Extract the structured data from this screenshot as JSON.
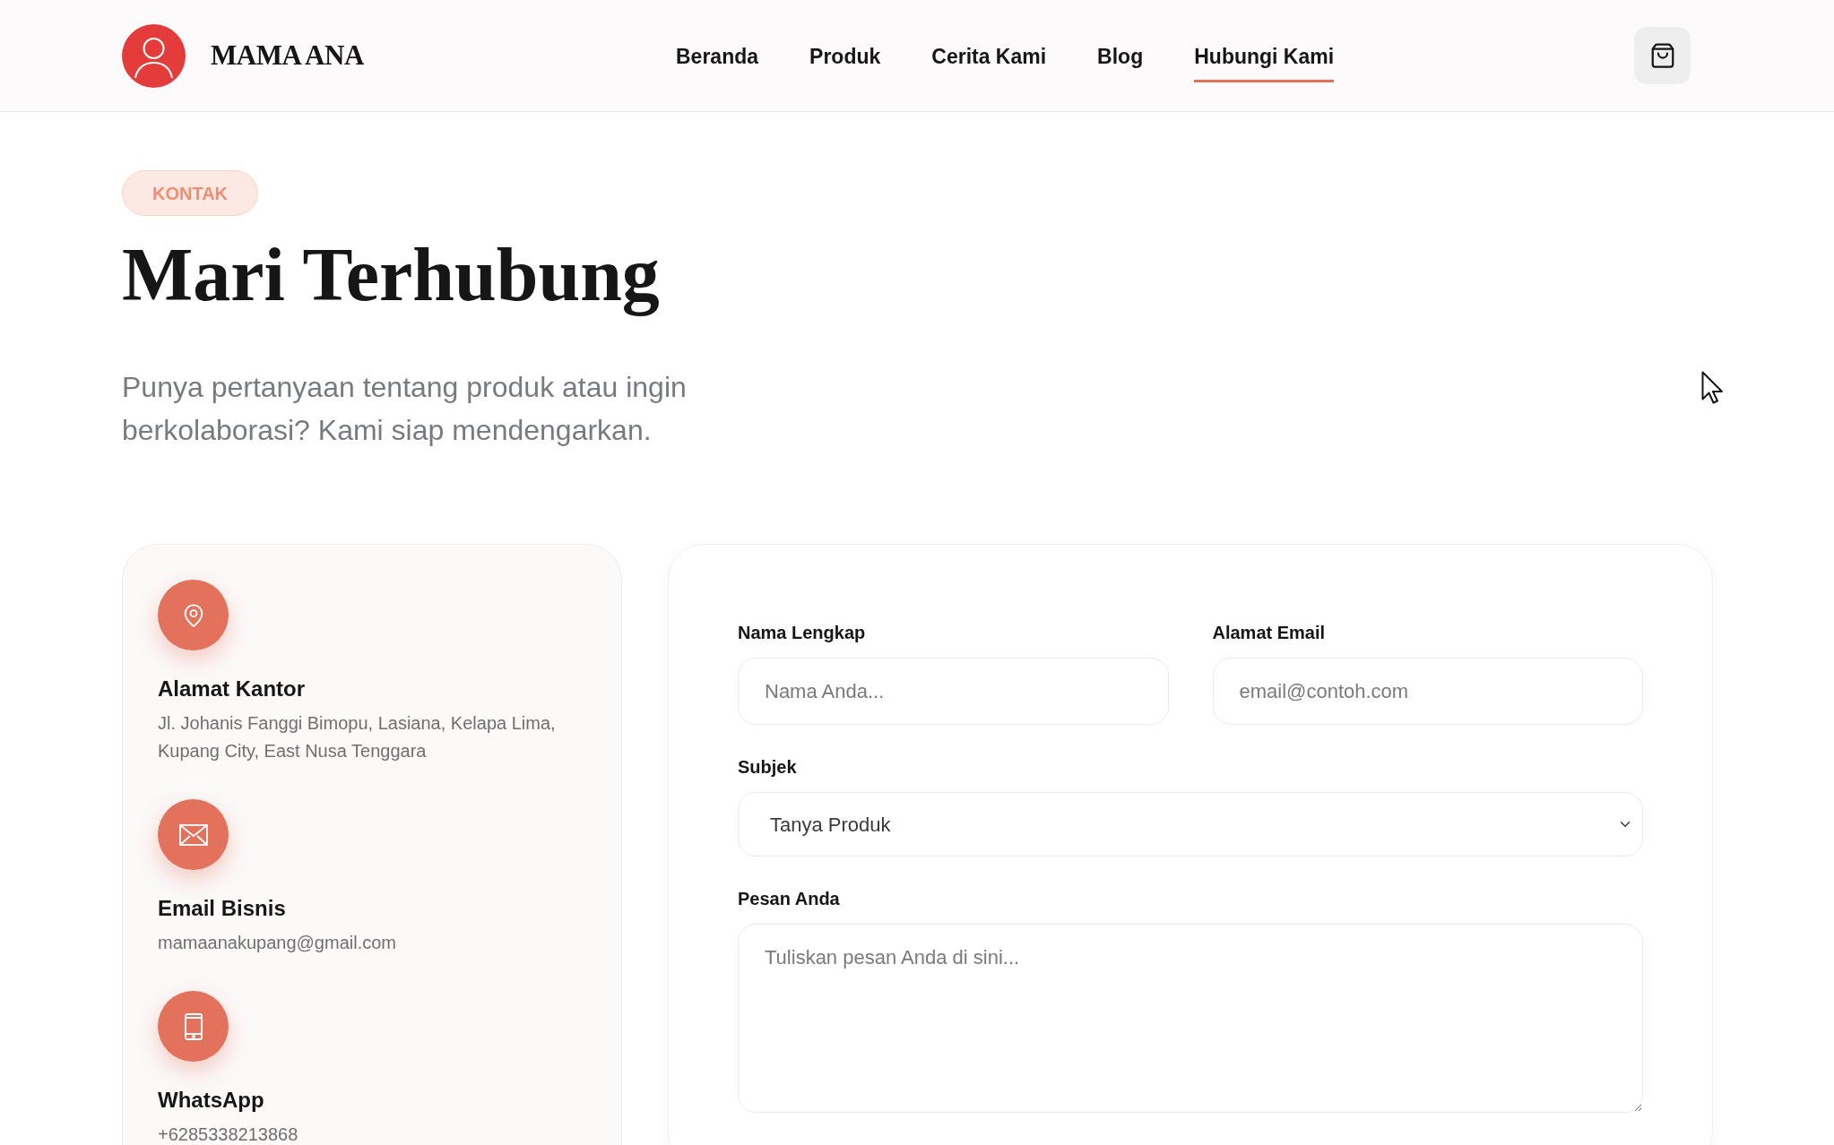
{
  "header": {
    "brand": "MAMA ANA",
    "nav": [
      {
        "label": "Beranda",
        "selected": false
      },
      {
        "label": "Produk",
        "selected": false
      },
      {
        "label": "Cerita Kami",
        "selected": false
      },
      {
        "label": "Blog",
        "selected": false
      },
      {
        "label": "Hubungi Kami",
        "selected": true
      }
    ]
  },
  "hero": {
    "badge": "KONTAK",
    "title": "Mari Terhubung",
    "subtitle": "Punya pertanyaan tentang produk atau ingin berkolaborasi? Kami siap mendengarkan."
  },
  "contact_info": [
    {
      "kind": "location",
      "title": "Alamat Kantor",
      "text": "Jl. Johanis Fanggi Bimopu, Lasiana, Kelapa Lima, Kupang City, East Nusa Tenggara"
    },
    {
      "kind": "email",
      "title": "Email Bisnis",
      "text": "mamaanakupang@gmail.com"
    },
    {
      "kind": "phone",
      "title": "WhatsApp",
      "text": "+6285338213868"
    }
  ],
  "form": {
    "fields": [
      {
        "kind": "input",
        "label": "Nama Lengkap",
        "placeholder": "Nama Anda..."
      },
      {
        "kind": "input",
        "label": "Alamat Email",
        "placeholder": "email@contoh.com"
      },
      {
        "kind": "select",
        "label": "Subjek",
        "value": "Tanya Produk"
      },
      {
        "kind": "textarea",
        "label": "Pesan Anda",
        "placeholder": "Tuliskan pesan Anda di sini..."
      }
    ]
  }
}
